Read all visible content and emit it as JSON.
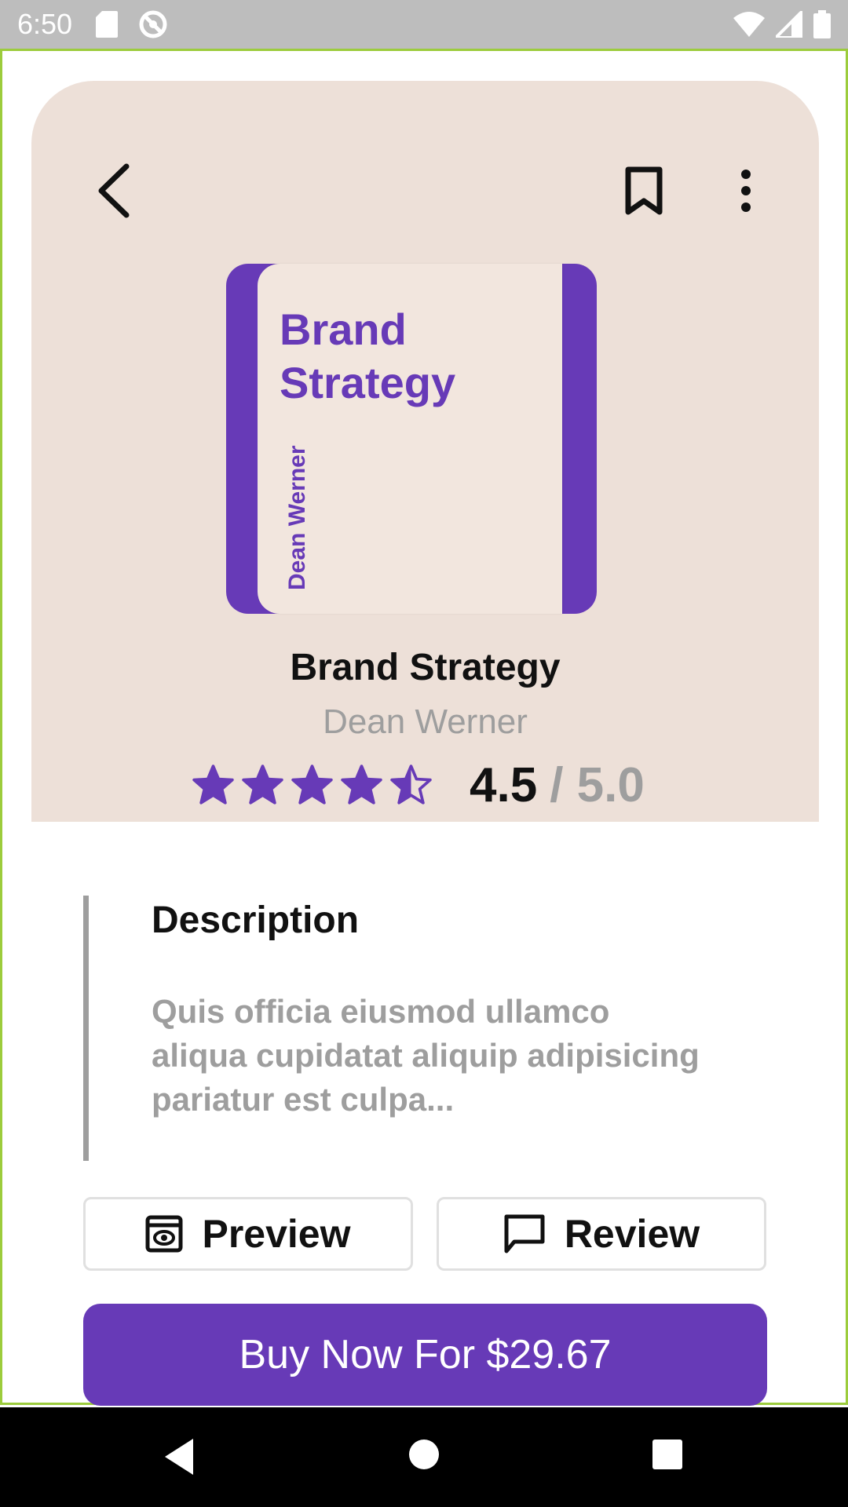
{
  "status_bar": {
    "time": "6:50"
  },
  "book": {
    "cover_title": "Brand Strategy",
    "cover_author": "Dean Werner",
    "title": "Brand Strategy",
    "author": "Dean Werner",
    "rating": "4.5",
    "rating_max": "/ 5.0",
    "rating_value": 4.5,
    "stars_total": 5
  },
  "description": {
    "heading": "Description",
    "text": "Quis officia eiusmod ullamco aliqua cupidatat aliquip adipisicing pariatur est culpa..."
  },
  "actions": {
    "preview_label": "Preview",
    "review_label": "Review",
    "buy_label": "Buy Now For $29.67"
  },
  "colors": {
    "accent": "#673ab7",
    "hero_bg": "#ede0d8",
    "muted_text": "#9e9e9e"
  }
}
